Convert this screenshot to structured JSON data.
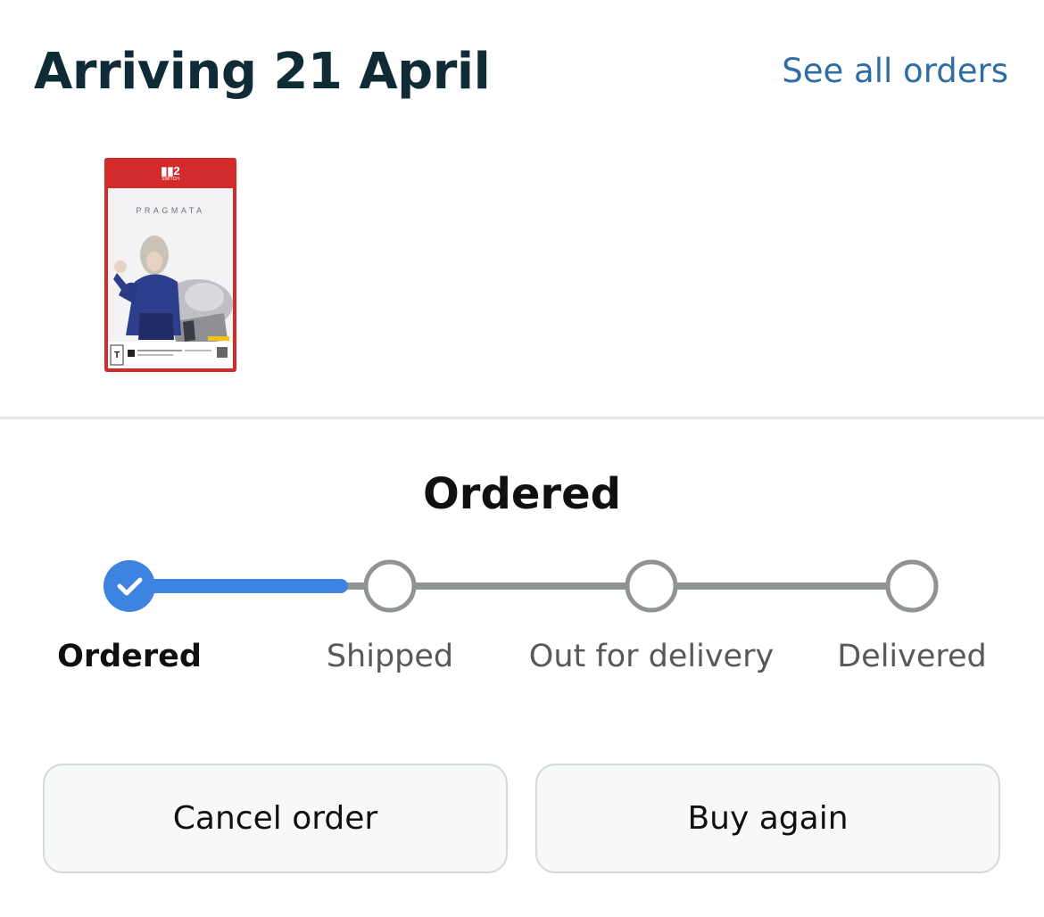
{
  "header": {
    "title": "Arriving 21 April",
    "see_all_link": "See all orders"
  },
  "product": {
    "platform_logo": "2",
    "platform_text": "SWITCH",
    "game_title": "PRAGMATA",
    "image_icon": "game-boxart"
  },
  "status": {
    "title": "Ordered",
    "progress_fraction": 0.333,
    "steps": [
      {
        "label": "Ordered",
        "state": "complete"
      },
      {
        "label": "Shipped",
        "state": "pending"
      },
      {
        "label": "Out for delivery",
        "state": "pending"
      },
      {
        "label": "Delivered",
        "state": "pending"
      }
    ],
    "colors": {
      "active": "#3d83e0",
      "inactive": "#8f9393"
    }
  },
  "actions": {
    "cancel_label": "Cancel order",
    "buy_again_label": "Buy again"
  }
}
